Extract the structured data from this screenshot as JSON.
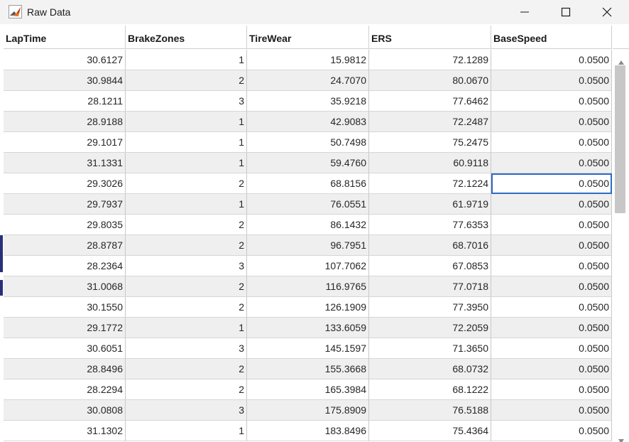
{
  "window": {
    "title": "Raw Data",
    "icon": "matlab-icon",
    "controls": [
      "minimize-icon",
      "maximize-icon",
      "close-icon"
    ]
  },
  "table": {
    "columns": [
      "LapTime",
      "BrakeZones",
      "TireWear",
      "ERS",
      "BaseSpeed"
    ],
    "rows": [
      [
        "30.6127",
        "1",
        "15.9812",
        "72.1289",
        "0.0500"
      ],
      [
        "30.9844",
        "2",
        "24.7070",
        "80.0670",
        "0.0500"
      ],
      [
        "28.1211",
        "3",
        "35.9218",
        "77.6462",
        "0.0500"
      ],
      [
        "28.9188",
        "1",
        "42.9083",
        "72.2487",
        "0.0500"
      ],
      [
        "29.1017",
        "1",
        "50.7498",
        "75.2475",
        "0.0500"
      ],
      [
        "31.1331",
        "1",
        "59.4760",
        "60.9118",
        "0.0500"
      ],
      [
        "29.3026",
        "2",
        "68.8156",
        "72.1224",
        "0.0500"
      ],
      [
        "29.7937",
        "1",
        "76.0551",
        "61.9719",
        "0.0500"
      ],
      [
        "29.8035",
        "2",
        "86.1432",
        "77.6353",
        "0.0500"
      ],
      [
        "28.8787",
        "2",
        "96.7951",
        "68.7016",
        "0.0500"
      ],
      [
        "28.2364",
        "3",
        "107.7062",
        "67.0853",
        "0.0500"
      ],
      [
        "31.0068",
        "2",
        "116.9765",
        "77.0718",
        "0.0500"
      ],
      [
        "30.1550",
        "2",
        "126.1909",
        "77.3950",
        "0.0500"
      ],
      [
        "29.1772",
        "1",
        "133.6059",
        "72.2059",
        "0.0500"
      ],
      [
        "30.6051",
        "3",
        "145.1597",
        "71.3650",
        "0.0500"
      ],
      [
        "28.8496",
        "2",
        "155.3668",
        "68.0732",
        "0.0500"
      ],
      [
        "28.2294",
        "2",
        "165.3984",
        "68.1222",
        "0.0500"
      ],
      [
        "30.0808",
        "3",
        "175.8909",
        "76.5188",
        "0.0500"
      ],
      [
        "31.1302",
        "1",
        "183.8496",
        "75.4364",
        "0.0500"
      ]
    ],
    "selected_cell": {
      "row": 6,
      "col": 4
    },
    "colors": {
      "stripe": "#efefef",
      "selection": "#2e6bc6",
      "grid": "#c8c8c8"
    }
  },
  "scrollbar": {
    "up_icon": "scroll-up-arrow-icon",
    "down_icon": "scroll-down-arrow-icon"
  }
}
